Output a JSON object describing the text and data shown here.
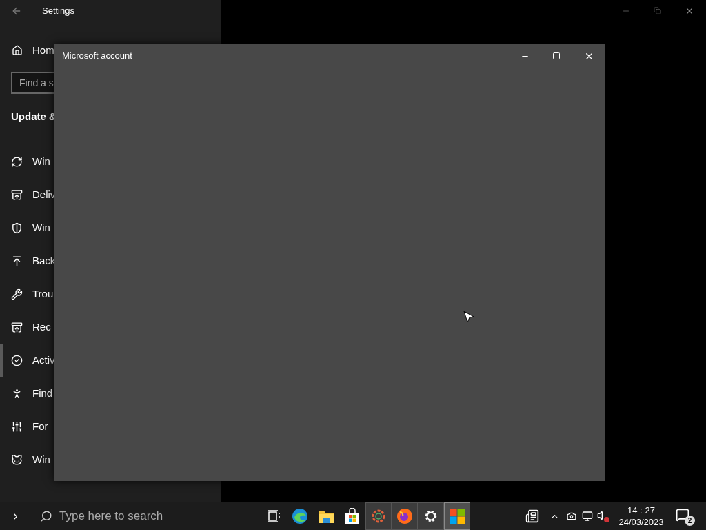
{
  "settings_window": {
    "title": "Settings",
    "home": "Hom",
    "search_placeholder": "Find a s",
    "section": "Update &",
    "items": [
      {
        "label": "Win",
        "selected": false
      },
      {
        "label": "Deliv",
        "selected": false
      },
      {
        "label": "Win",
        "selected": false
      },
      {
        "label": "Back",
        "selected": false
      },
      {
        "label": "Trou",
        "selected": false
      },
      {
        "label": "Rec",
        "selected": false
      },
      {
        "label": "Activ",
        "selected": true
      },
      {
        "label": "Find",
        "selected": false
      },
      {
        "label": "For",
        "selected": false
      },
      {
        "label": "Win",
        "selected": false
      }
    ]
  },
  "dialog": {
    "title": "Microsoft account"
  },
  "taskbar": {
    "search_placeholder": "Type here to search",
    "apps": [
      {
        "running": false,
        "selected": false
      },
      {
        "running": false,
        "selected": false
      },
      {
        "running": false,
        "selected": false
      },
      {
        "running": false,
        "selected": false
      },
      {
        "running": true,
        "selected": false
      },
      {
        "running": true,
        "selected": false
      },
      {
        "running": true,
        "selected": false
      },
      {
        "running": true,
        "selected": true
      }
    ],
    "time": "14 : 27",
    "date": "24/03/2023",
    "notification_count": "2"
  }
}
